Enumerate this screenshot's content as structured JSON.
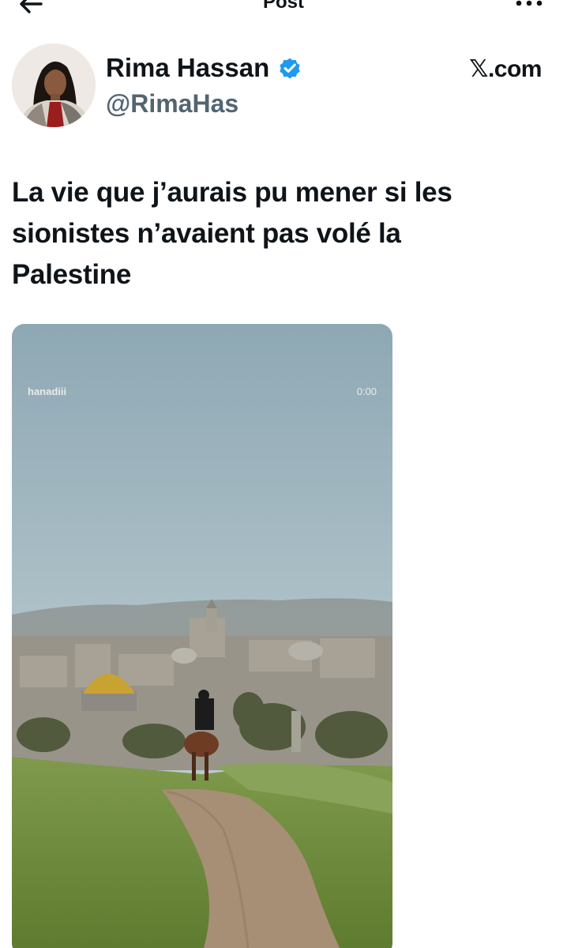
{
  "topbar": {
    "title": "Post",
    "back_icon": "arrow-left-icon",
    "more_icon": "more-horizontal-icon"
  },
  "author": {
    "name": "Rima Hassan",
    "handle": "@RimaHas",
    "verified_icon": "verified-badge-icon",
    "verified_color": "#1d9bf0"
  },
  "brand": "𝕏.com",
  "post": {
    "text": "La vie que j’aurais pu mener si les sionistes n’avaient pas volé la Palestine"
  },
  "media": {
    "username": "hanadiii",
    "timestamp": "0:00"
  },
  "colors": {
    "text_primary": "#0f1419",
    "text_secondary": "#536471",
    "accent": "#1d9bf0"
  }
}
